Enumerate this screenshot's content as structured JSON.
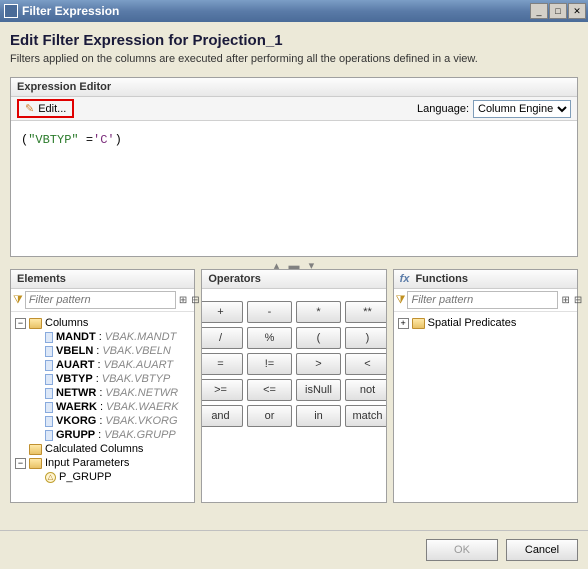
{
  "window": {
    "title": "Filter Expression"
  },
  "heading": "Edit Filter Expression for Projection_1",
  "subheading": "Filters applied on the columns are executed after performing all the operations defined in a view.",
  "editor": {
    "title": "Expression Editor",
    "edit_label": "Edit...",
    "language_label": "Language:",
    "language_value": "Column Engine",
    "expr_str1": "\"VBTYP\"",
    "expr_op": "=",
    "expr_str2": "'C'"
  },
  "elements": {
    "title": "Elements",
    "filter_placeholder": "Filter pattern",
    "columns_label": "Columns",
    "calc_columns_label": "Calculated Columns",
    "input_params_label": "Input Parameters",
    "cols": [
      {
        "name": "MANDT",
        "desc": "VBAK.MANDT"
      },
      {
        "name": "VBELN",
        "desc": "VBAK.VBELN"
      },
      {
        "name": "AUART",
        "desc": "VBAK.AUART"
      },
      {
        "name": "VBTYP",
        "desc": "VBAK.VBTYP"
      },
      {
        "name": "NETWR",
        "desc": "VBAK.NETWR"
      },
      {
        "name": "WAERK",
        "desc": "VBAK.WAERK"
      },
      {
        "name": "VKORG",
        "desc": "VBAK.VKORG"
      },
      {
        "name": "GRUPP",
        "desc": "VBAK.GRUPP"
      }
    ],
    "params": [
      {
        "name": "P_GRUPP"
      }
    ]
  },
  "operators": {
    "title": "Operators",
    "ops": [
      "+",
      "-",
      "*",
      "**",
      "/",
      "%",
      "(",
      ")",
      "=",
      "!=",
      ">",
      "<",
      ">=",
      "<=",
      "isNull",
      "not",
      "and",
      "or",
      "in",
      "match"
    ]
  },
  "functions": {
    "title": "Functions",
    "filter_placeholder": "Filter pattern",
    "nodes": [
      {
        "label": "Spatial Predicates"
      }
    ]
  },
  "footer": {
    "ok": "OK",
    "cancel": "Cancel"
  }
}
